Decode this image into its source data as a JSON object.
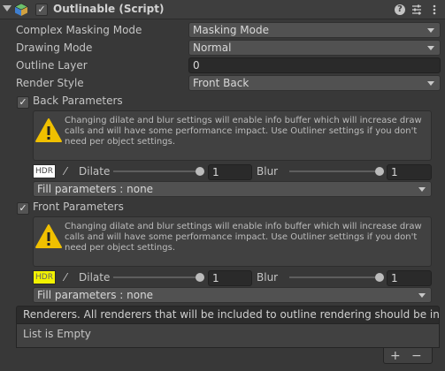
{
  "header": {
    "title": "Outlinable (Script)",
    "enabled": true,
    "icons": [
      "foldout-arrow-icon",
      "script-cube-icon",
      "help-icon",
      "presets-icon",
      "more-options-icon"
    ]
  },
  "fields": {
    "complex_masking_mode": {
      "label": "Complex Masking Mode",
      "value": "Masking Mode"
    },
    "drawing_mode": {
      "label": "Drawing Mode",
      "value": "Normal"
    },
    "outline_layer": {
      "label": "Outline Layer",
      "value": "0"
    },
    "render_style": {
      "label": "Render Style",
      "value": "Front Back"
    }
  },
  "back": {
    "label": "Back Parameters",
    "checked": true,
    "warning": "Changing dilate and blur settings will enable info buffer which will increase draw calls and will have some performance impact. Use Outliner settings if you don't need per object settings.",
    "hdr_label": "HDR",
    "hdr_color": "#ffffff",
    "dilate_label": "Dilate",
    "dilate_value": "1",
    "blur_label": "Blur",
    "blur_value": "1",
    "fill": "Fill parameters : none"
  },
  "front": {
    "label": "Front Parameters",
    "checked": true,
    "warning": "Changing dilate and blur settings will enable info buffer which will increase draw calls and will have some performance impact. Use Outliner settings if you don't need per object settings.",
    "hdr_label": "HDR",
    "hdr_color": "#f2f200",
    "dilate_label": "Dilate",
    "dilate_value": "1",
    "blur_label": "Blur",
    "blur_value": "1",
    "fill": "Fill parameters : none"
  },
  "renderers": {
    "header": "Renderers. All renderers that will be included to outline rendering should be in the list",
    "empty": "List is Empty",
    "add_label": "+",
    "remove_label": "−"
  },
  "checkmark": "✓",
  "colors": {
    "background": "#383838",
    "header": "#3e3e3e",
    "field": "#2a2a2a",
    "dropdown": "#515151",
    "warning": "#f0c000"
  }
}
